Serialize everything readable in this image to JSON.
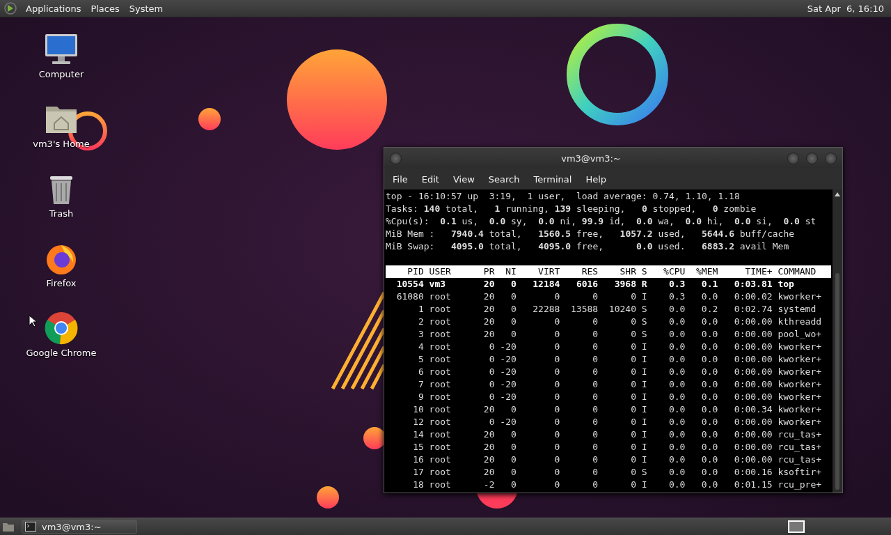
{
  "top_panel": {
    "menus": [
      "Applications",
      "Places",
      "System"
    ],
    "clock": "Sat Apr  6, 16:10"
  },
  "desktop_icons": [
    {
      "kind": "computer",
      "label": "Computer"
    },
    {
      "kind": "home",
      "label": "vm3's Home"
    },
    {
      "kind": "trash",
      "label": "Trash"
    },
    {
      "kind": "firefox",
      "label": "Firefox"
    },
    {
      "kind": "chrome",
      "label": "Google Chrome"
    }
  ],
  "terminal": {
    "title": "vm3@vm3:~",
    "menu": [
      "File",
      "Edit",
      "View",
      "Search",
      "Terminal",
      "Help"
    ],
    "summary": [
      "top - 16:10:57 up  3:19,  1 user,  load average: 0.74, 1.10, 1.18",
      "Tasks: **140** total,   **1** running, **139** sleeping,   **0** stopped,   **0** zombie",
      "%Cpu(s):  **0.1** us,  **0.0** sy,  **0.0** ni, **99.9** id,  **0.0** wa,  **0.0** hi,  **0.0** si,  **0.0** st",
      "MiB Mem :   **7940.4** total,   **1560.5** free,   **1057.2** used,   **5644.6** buff/cache",
      "MiB Swap:   **4095.0** total,   **4095.0** free,      **0.0** used.   **6883.2** avail Mem"
    ],
    "columns": [
      "PID",
      "USER",
      "PR",
      "NI",
      "VIRT",
      "RES",
      "SHR",
      "S",
      "%CPU",
      "%MEM",
      "TIME+",
      "COMMAND"
    ],
    "rows": [
      {
        "highlighted": true,
        "cells": [
          "10554",
          "vm3",
          "20",
          "0",
          "12184",
          "6016",
          "3968",
          "R",
          "0.3",
          "0.1",
          "0:03.81",
          "top"
        ]
      },
      {
        "highlighted": false,
        "cells": [
          "61080",
          "root",
          "20",
          "0",
          "0",
          "0",
          "0",
          "I",
          "0.3",
          "0.0",
          "0:00.02",
          "kworker+"
        ]
      },
      {
        "highlighted": false,
        "cells": [
          "1",
          "root",
          "20",
          "0",
          "22288",
          "13588",
          "10240",
          "S",
          "0.0",
          "0.2",
          "0:02.74",
          "systemd"
        ]
      },
      {
        "highlighted": false,
        "cells": [
          "2",
          "root",
          "20",
          "0",
          "0",
          "0",
          "0",
          "S",
          "0.0",
          "0.0",
          "0:00.00",
          "kthreadd"
        ]
      },
      {
        "highlighted": false,
        "cells": [
          "3",
          "root",
          "20",
          "0",
          "0",
          "0",
          "0",
          "S",
          "0.0",
          "0.0",
          "0:00.00",
          "pool_wo+"
        ]
      },
      {
        "highlighted": false,
        "cells": [
          "4",
          "root",
          "0",
          "-20",
          "0",
          "0",
          "0",
          "I",
          "0.0",
          "0.0",
          "0:00.00",
          "kworker+"
        ]
      },
      {
        "highlighted": false,
        "cells": [
          "5",
          "root",
          "0",
          "-20",
          "0",
          "0",
          "0",
          "I",
          "0.0",
          "0.0",
          "0:00.00",
          "kworker+"
        ]
      },
      {
        "highlighted": false,
        "cells": [
          "6",
          "root",
          "0",
          "-20",
          "0",
          "0",
          "0",
          "I",
          "0.0",
          "0.0",
          "0:00.00",
          "kworker+"
        ]
      },
      {
        "highlighted": false,
        "cells": [
          "7",
          "root",
          "0",
          "-20",
          "0",
          "0",
          "0",
          "I",
          "0.0",
          "0.0",
          "0:00.00",
          "kworker+"
        ]
      },
      {
        "highlighted": false,
        "cells": [
          "9",
          "root",
          "0",
          "-20",
          "0",
          "0",
          "0",
          "I",
          "0.0",
          "0.0",
          "0:00.00",
          "kworker+"
        ]
      },
      {
        "highlighted": false,
        "cells": [
          "10",
          "root",
          "20",
          "0",
          "0",
          "0",
          "0",
          "I",
          "0.0",
          "0.0",
          "0:00.34",
          "kworker+"
        ]
      },
      {
        "highlighted": false,
        "cells": [
          "12",
          "root",
          "0",
          "-20",
          "0",
          "0",
          "0",
          "I",
          "0.0",
          "0.0",
          "0:00.00",
          "kworker+"
        ]
      },
      {
        "highlighted": false,
        "cells": [
          "14",
          "root",
          "20",
          "0",
          "0",
          "0",
          "0",
          "I",
          "0.0",
          "0.0",
          "0:00.00",
          "rcu_tas+"
        ]
      },
      {
        "highlighted": false,
        "cells": [
          "15",
          "root",
          "20",
          "0",
          "0",
          "0",
          "0",
          "I",
          "0.0",
          "0.0",
          "0:00.00",
          "rcu_tas+"
        ]
      },
      {
        "highlighted": false,
        "cells": [
          "16",
          "root",
          "20",
          "0",
          "0",
          "0",
          "0",
          "I",
          "0.0",
          "0.0",
          "0:00.00",
          "rcu_tas+"
        ]
      },
      {
        "highlighted": false,
        "cells": [
          "17",
          "root",
          "20",
          "0",
          "0",
          "0",
          "0",
          "S",
          "0.0",
          "0.0",
          "0:00.16",
          "ksoftir+"
        ]
      },
      {
        "highlighted": false,
        "cells": [
          "18",
          "root",
          "-2",
          "0",
          "0",
          "0",
          "0",
          "I",
          "0.0",
          "0.0",
          "0:01.15",
          "rcu_pre+"
        ]
      }
    ]
  },
  "taskbar": {
    "tasks": [
      {
        "label": "vm3@vm3:~",
        "selected": false
      }
    ],
    "workspaces": [
      {
        "selected": true
      }
    ]
  }
}
